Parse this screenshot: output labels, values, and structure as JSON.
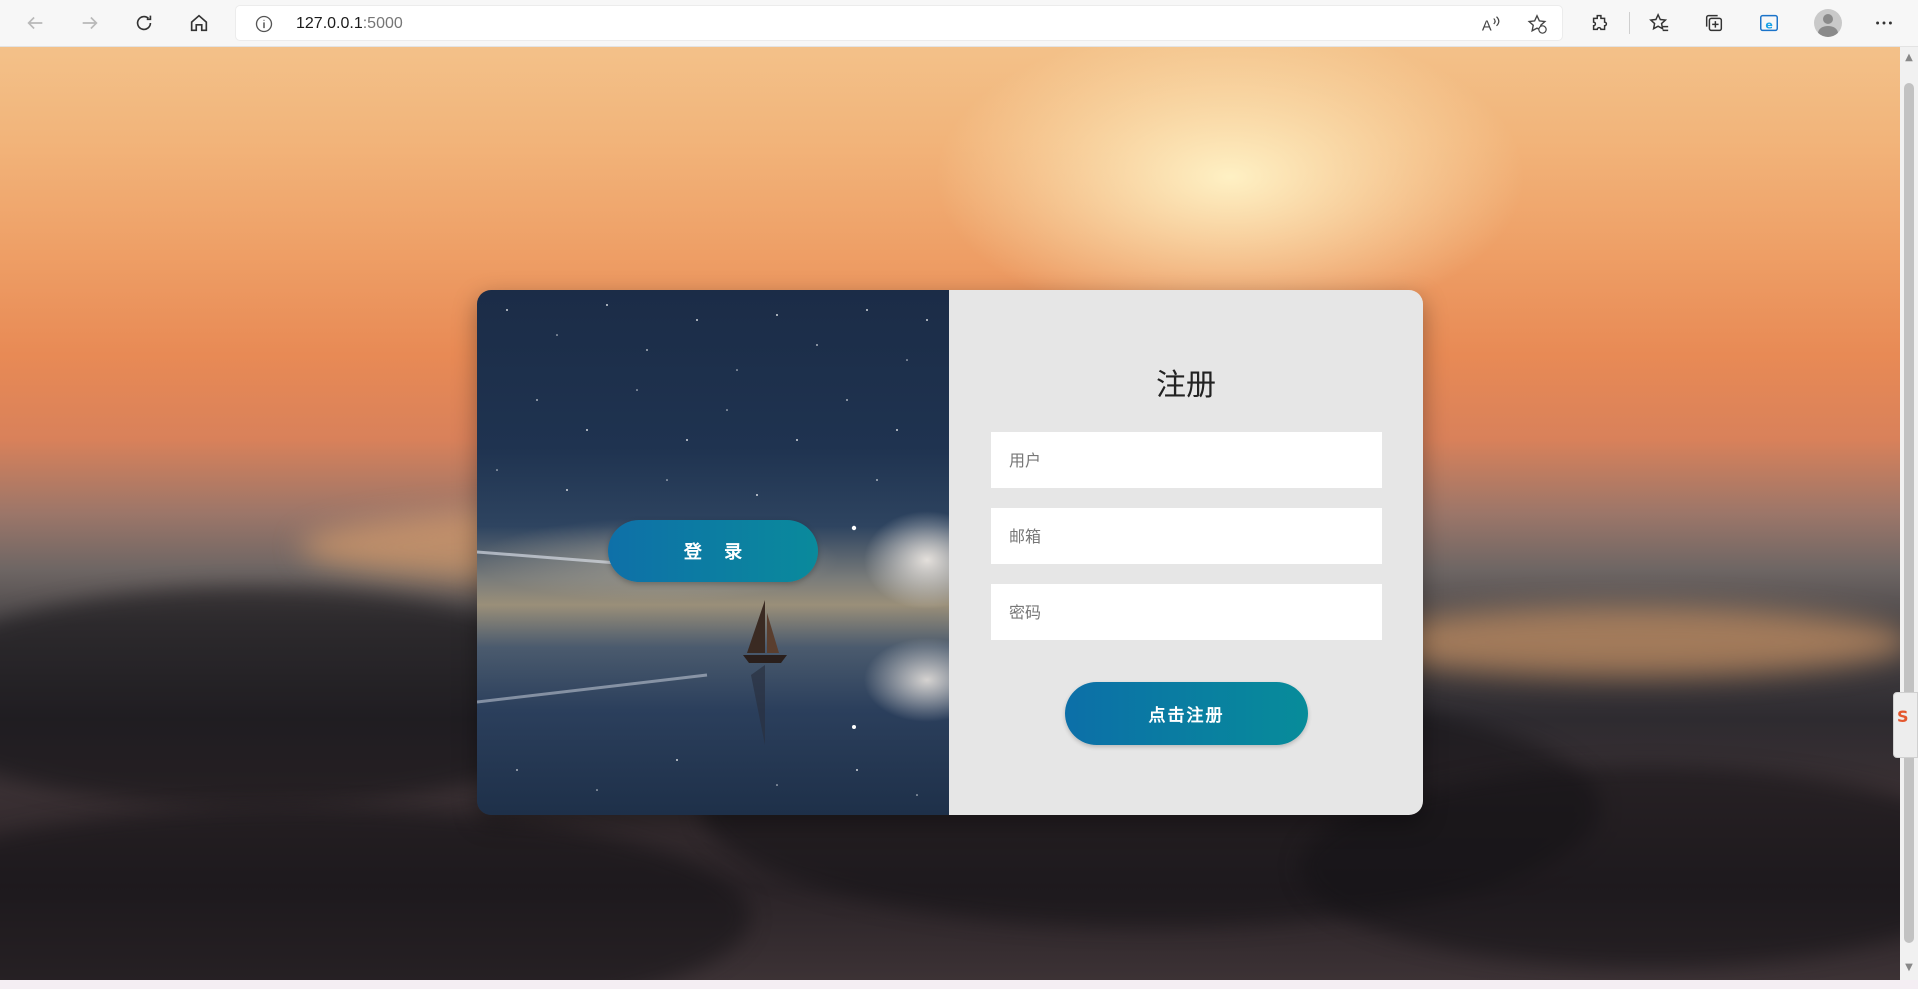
{
  "browser": {
    "url_host": "127.0.0.1",
    "url_port": ":5000",
    "icons": [
      "back-arrow-icon",
      "forward-arrow-icon",
      "refresh-icon",
      "home-icon",
      "info-icon",
      "read-aloud-icon",
      "add-favorite-icon",
      "extensions-icon",
      "favorites-icon",
      "collections-icon",
      "edge-bar-icon",
      "profile-avatar",
      "more-menu-icon"
    ]
  },
  "login_panel": {
    "login_button_label": "登 录"
  },
  "register_form": {
    "title": "注册",
    "username_placeholder": "用户",
    "email_placeholder": "邮箱",
    "password_placeholder": "密码",
    "submit_label": "点击注册"
  },
  "colors": {
    "button_gradient_start": "#0e70a8",
    "button_gradient_end": "#0a8a9c",
    "form_background": "#e6e6e6"
  }
}
